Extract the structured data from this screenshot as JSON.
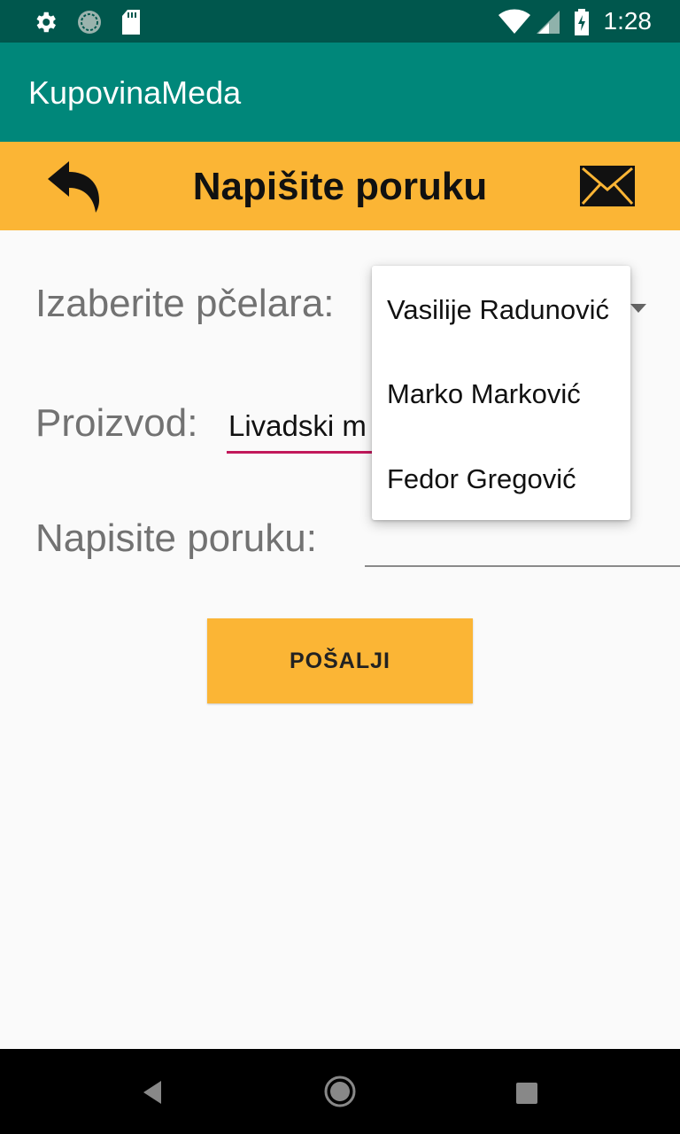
{
  "status_bar": {
    "time": "1:28",
    "icons": [
      "settings-icon",
      "sync-icon",
      "sd-card-icon",
      "wifi-icon",
      "signal-icon",
      "battery-icon"
    ]
  },
  "app_bar": {
    "title": "KupovinaMeda"
  },
  "header": {
    "title": "Napišite poruku",
    "back_icon": "reply-arrow-icon",
    "mail_icon": "envelope-icon"
  },
  "form": {
    "beekeeper_label": "Izaberite pčelara:",
    "product_label": "Proizvod:",
    "product_value": "Livadski m",
    "message_label": "Napisite poruku:",
    "message_value": ""
  },
  "dropdown": {
    "options": [
      "Vasilije Radunović",
      "Marko Marković",
      "Fedor Gregović"
    ]
  },
  "send_button": {
    "label": "POŠALJI"
  },
  "nav_bar": {
    "icons": [
      "back-icon",
      "home-icon",
      "recents-icon"
    ]
  },
  "colors": {
    "status_bar": "#00574d",
    "app_bar": "#00877a",
    "accent": "#fbb535",
    "underline_active": "#c2185b"
  }
}
